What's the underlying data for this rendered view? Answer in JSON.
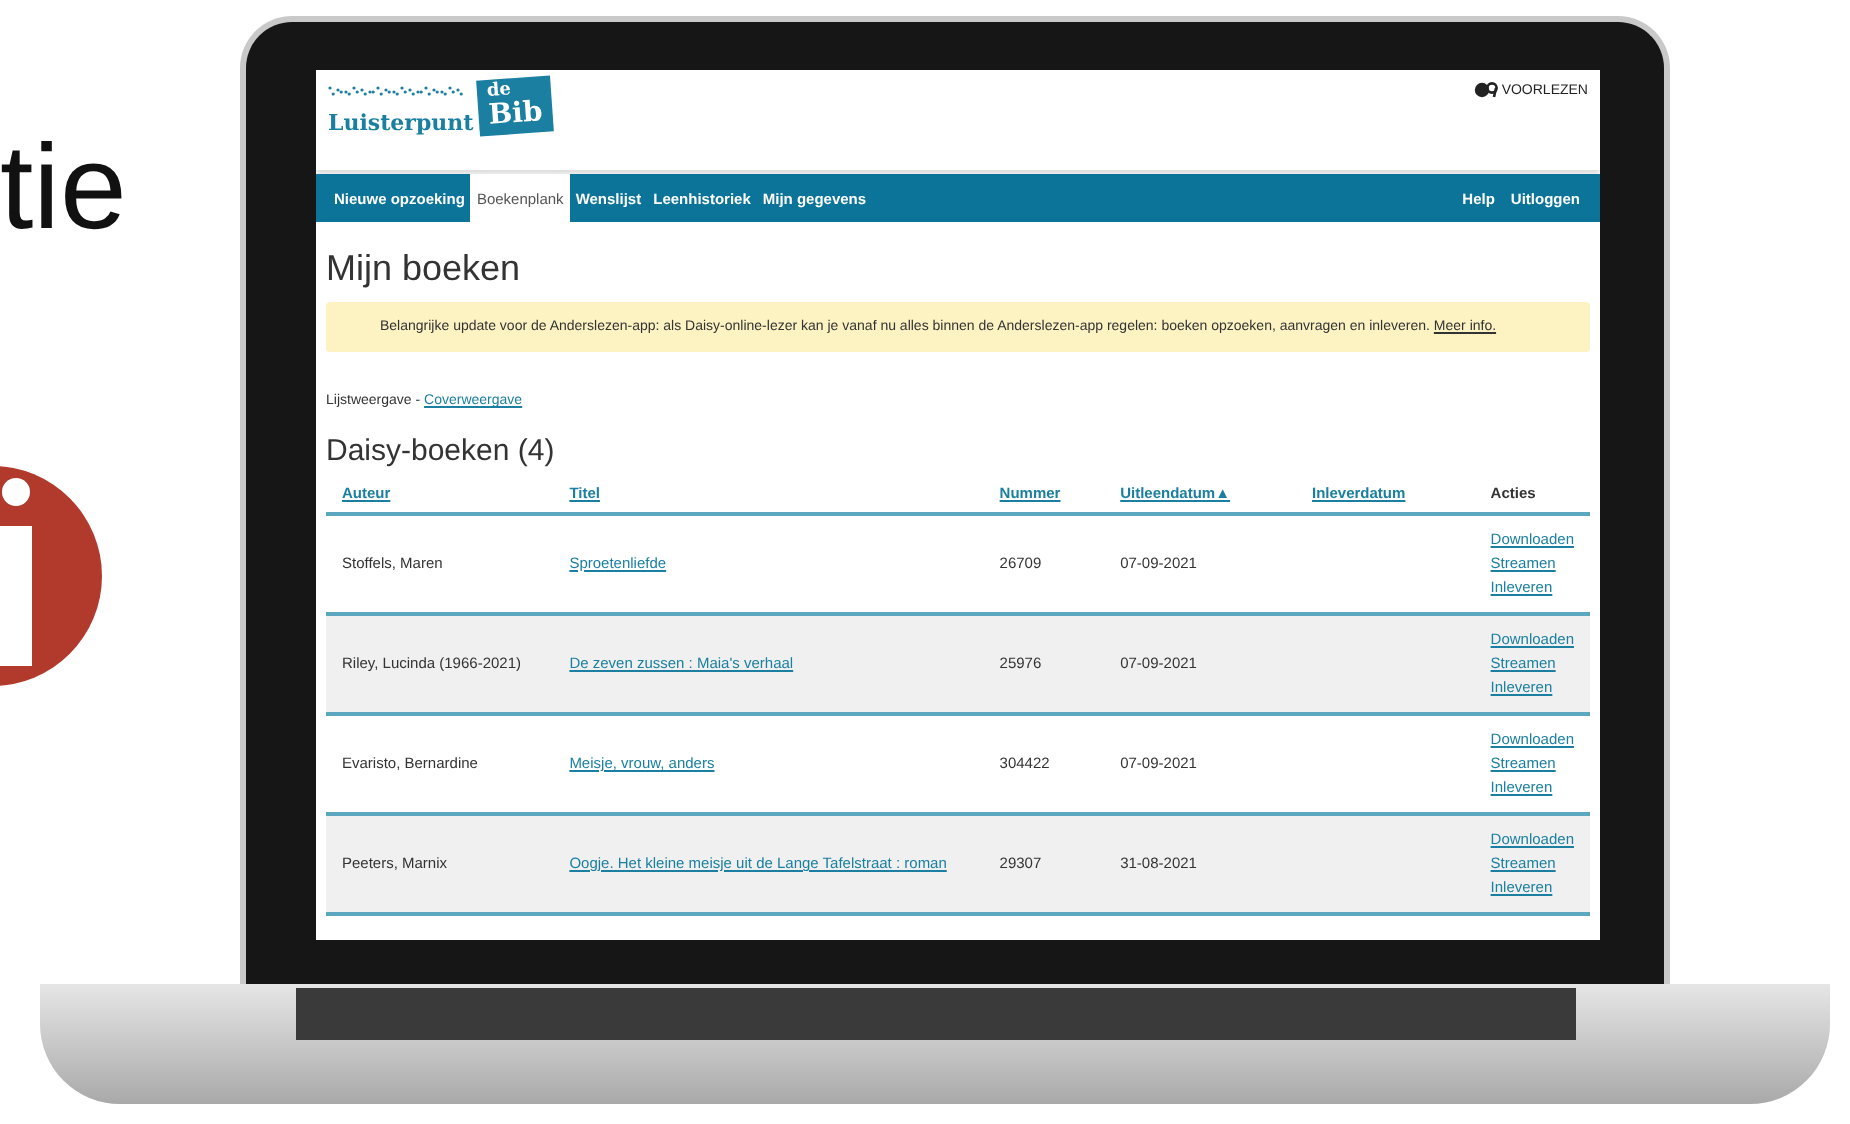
{
  "slide": {
    "title_fragment": "tie"
  },
  "site": {
    "logo": {
      "name": "Luisterpunt",
      "badge_top": "de",
      "badge_main": "Bib"
    },
    "read_aloud": "VOORLEZEN"
  },
  "nav": {
    "items": [
      {
        "label": "Nieuwe opzoeking",
        "selected": false
      },
      {
        "label": "Boekenplank",
        "selected": true
      },
      {
        "label": "Wenslijst",
        "selected": false
      },
      {
        "label": "Leenhistoriek",
        "selected": false
      },
      {
        "label": "Mijn gegevens",
        "selected": false
      }
    ],
    "right_items": [
      "Help",
      "Uitloggen"
    ]
  },
  "heading": "Mijn boeken",
  "notice": {
    "text": "Belangrijke update voor de Anderslezen-app: als Daisy-online-lezer kan je vanaf nu alles binnen de Anderslezen-app regelen: boeken opzoeken, aanvragen en inleveren.",
    "link": "Meer info."
  },
  "view_switch": {
    "current": "Lijstweergave -",
    "link": "Coverweergave"
  },
  "section_title": "Daisy-boeken (4)",
  "table": {
    "columns": [
      {
        "label": "Auteur",
        "kind": "link"
      },
      {
        "label": "Titel",
        "kind": "link"
      },
      {
        "label": "Nummer",
        "kind": "link"
      },
      {
        "label": "Uitleendatum",
        "kind": "link",
        "sort_indicator": "▲"
      },
      {
        "label": "Inleverdatum",
        "kind": "link"
      },
      {
        "label": "Acties",
        "kind": "plain"
      }
    ],
    "rows": [
      {
        "author": "Stoffels, Maren",
        "title": "Sproetenliefde",
        "number": "26709",
        "loan_date": "07-09-2021",
        "actions": [
          "Downloaden",
          "Streamen",
          "Inleveren"
        ]
      },
      {
        "author": "Riley, Lucinda (1966-2021)",
        "title": "De zeven zussen : Maia's verhaal",
        "number": "25976",
        "loan_date": "07-09-2021",
        "actions": [
          "Downloaden",
          "Streamen",
          "Inleveren"
        ]
      },
      {
        "author": "Evaristo, Bernardine",
        "title": "Meisje, vrouw, anders",
        "number": "304422",
        "loan_date": "07-09-2021",
        "actions": [
          "Downloaden",
          "Streamen",
          "Inleveren"
        ]
      },
      {
        "author": "Peeters, Marnix",
        "title": "Oogje. Het kleine meisje uit de Lange Tafelstraat : roman",
        "number": "29307",
        "loan_date": "31-08-2021",
        "actions": [
          "Downloaden",
          "Streamen",
          "Inleveren"
        ]
      }
    ]
  }
}
